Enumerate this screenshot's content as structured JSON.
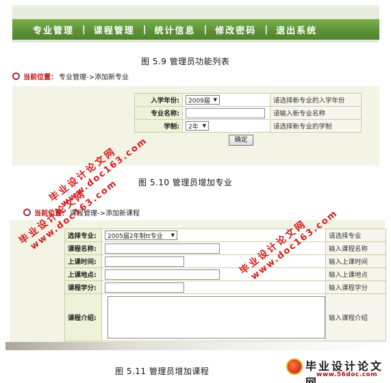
{
  "nav": {
    "items": [
      "专业管理",
      "课程管理",
      "统计信息",
      "修改密码",
      "退出系统"
    ],
    "separator": "|"
  },
  "captions": {
    "fig59": "图 5.9  管理员功能列表",
    "fig510": "图 5.10  管理员增加专业",
    "fig511": "图 5.11  管理员增加课程"
  },
  "add_major": {
    "location_label": "当前位置：",
    "location_path": "专业管理->添加新专业",
    "rows": [
      {
        "label": "入学年份:",
        "value": "2009届",
        "hint": "请选择新专业的入学年份"
      },
      {
        "label": "专业名称:",
        "value": "",
        "hint": "请输入新专业名称"
      },
      {
        "label": "学制:",
        "value": "2年",
        "hint": "请选择新专业的学制"
      }
    ],
    "submit_label": "确定"
  },
  "add_course": {
    "location_label": "当前位置：",
    "location_path": "课程管理->添加新课程",
    "rows": [
      {
        "label": "选择专业:",
        "value": "2005届2年制tt专业",
        "hint": "请选择专业"
      },
      {
        "label": "课程名称:",
        "value": "",
        "hint": "输入课程名称"
      },
      {
        "label": "上课时间:",
        "value": "",
        "hint": "输入上课时间"
      },
      {
        "label": "上课地点:",
        "value": "",
        "hint": "输入上课地点"
      },
      {
        "label": "课程学分:",
        "value": "",
        "hint": "输入课程学分"
      },
      {
        "label": "课程介绍:",
        "value": "",
        "hint": "输入课程介绍"
      }
    ]
  },
  "watermarks": {
    "cn": "毕业设计论文网",
    "url": "www.doc163.com"
  },
  "logo": {
    "title": "毕业设计论文网",
    "site": "www.56doc.com"
  },
  "colors": {
    "nav_green": "#5d9336",
    "label_bg": "#eef2d8",
    "watermark_red": "#d41c1c",
    "location_red": "#c01010"
  }
}
